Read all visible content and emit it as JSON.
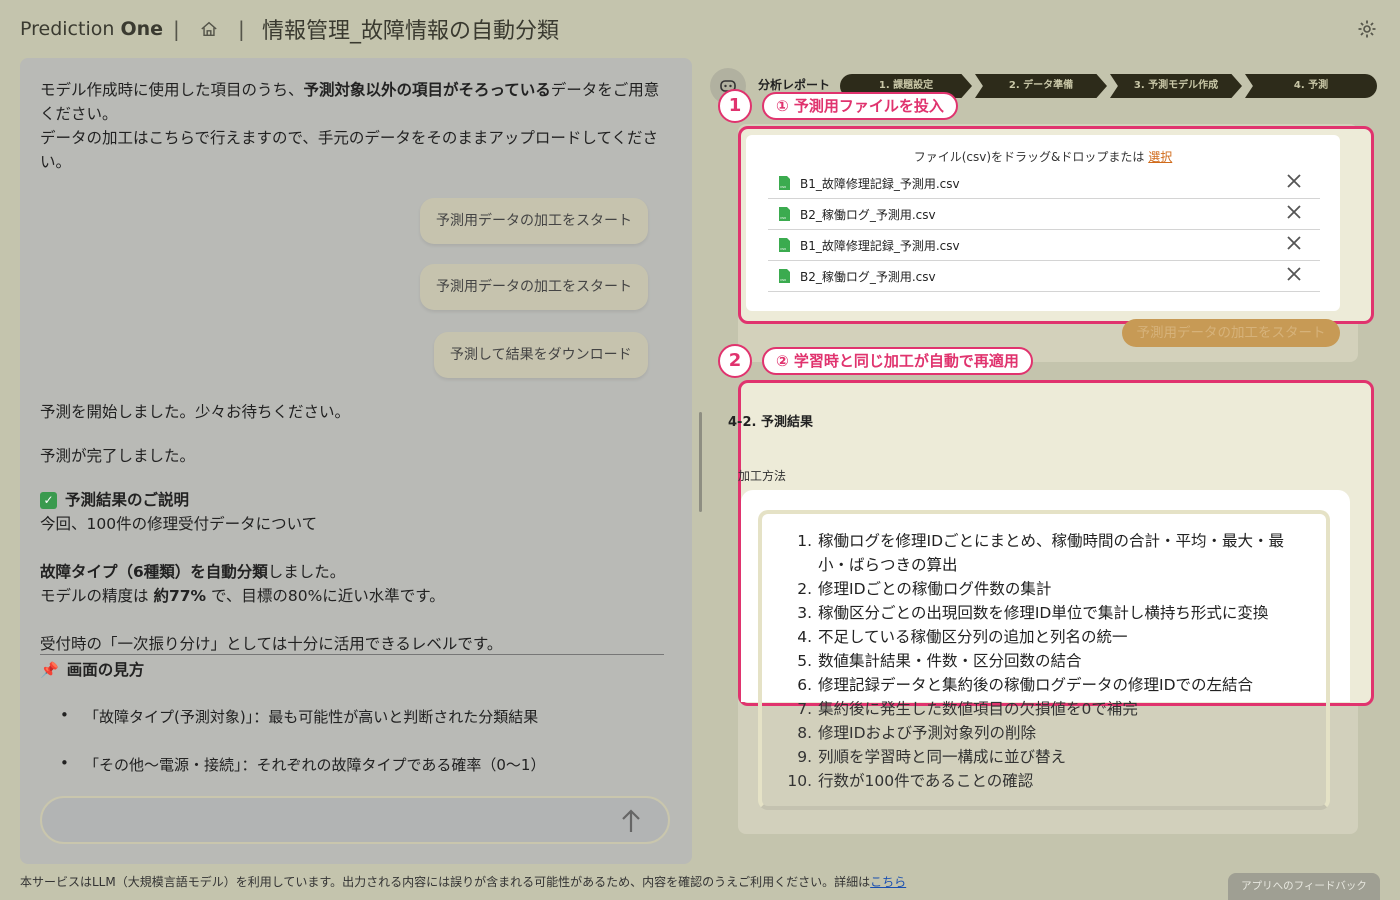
{
  "header": {
    "logo_light": "Prediction ",
    "logo_bold": "One",
    "sep1": "|",
    "sep2": "|",
    "title": "情報管理_故障情報の自動分類"
  },
  "chat": {
    "intro_1": "モデル作成時に使用した項目のうち、",
    "intro_bold": "予測対象以外の項目がそろっている",
    "intro_2": "データをご用意ください。",
    "intro_3": "データの加工はこちらで行えますので、手元のデータをそのままアップロードしてください。",
    "bubble_1": "予測用データの加工をスタート",
    "bubble_2": "予測用データの加工をスタート",
    "bubble_3": "予測して結果をダウンロード",
    "msg_start": "予測を開始しました。少々お待ちください。",
    "msg_done": "予測が完了しました。",
    "explain_heading": "予測結果のご説明",
    "explain_1": "今回、100件の修理受付データについて",
    "explain_bold": "故障タイプ（6種類）を自動分類",
    "explain_2": "しました。",
    "acc_1": "モデルの精度は ",
    "acc_bold": "約77%",
    "acc_2": " で、目標の80%に近い水準です。",
    "usage": "受付時の「一次振り分け」としては十分に活用できるレベルです。",
    "view_heading": "画面の見方",
    "bullet_1": "「故障タイプ(予測対象)」：最も可能性が高いと判断された分類結果",
    "bullet_2": "「その他〜電源・接続」：それぞれの故障タイプである確率（0〜1）"
  },
  "footer": {
    "note": "本サービスはLLM（大規模言語モデル）を利用しています。出力される内容には誤りが含まれる可能性があるため、内容を確認のうえご利用ください。詳細は",
    "link": "こちら",
    "feedback": "アプリへのフィードバック"
  },
  "report": {
    "label": "分析レポート",
    "steps": [
      "1. 課題設定",
      "2. データ準備",
      "3. 予測モデル作成",
      "4. 予測"
    ]
  },
  "callouts": {
    "n1": "1",
    "t1": "① 予測用ファイルを投入",
    "n2": "2",
    "t2": "② 学習時と同じ加工が自動で再適用"
  },
  "upload": {
    "prompt": "ファイル(csv)をドラッグ&ドロップまたは ",
    "select": "選択",
    "files": [
      "B1_故障修理記録_予測用.csv",
      "B2_稼働ログ_予測用.csv",
      "B1_故障修理記録_予測用.csv",
      "B2_稼働ログ_予測用.csv"
    ],
    "start_button": "予測用データの加工をスタート"
  },
  "result": {
    "title": "4-2. 予測結果",
    "method_label": "加工方法",
    "steps": [
      "稼働ログを修理IDごとにまとめ、稼働時間の合計・平均・最大・最小・ばらつきの算出",
      "修理IDごとの稼働ログ件数の集計",
      "稼働区分ごとの出現回数を修理ID単位で集計し横持ち形式に変換",
      "不足している稼働区分列の追加と列名の統一",
      "数値集計結果・件数・区分回数の結合",
      "修理記録データと集約後の稼働ログデータの修理IDでの左結合",
      "集約後に発生した数値項目の欠損値を0で補完",
      "修理IDおよび予測対象列の削除",
      "列順を学習時と同一構成に並び替え",
      "行数が100件であることの確認"
    ]
  },
  "colors": {
    "accent": "#e0336e",
    "background": "#c4c4ad",
    "step_bar": "#2d2b1a"
  }
}
